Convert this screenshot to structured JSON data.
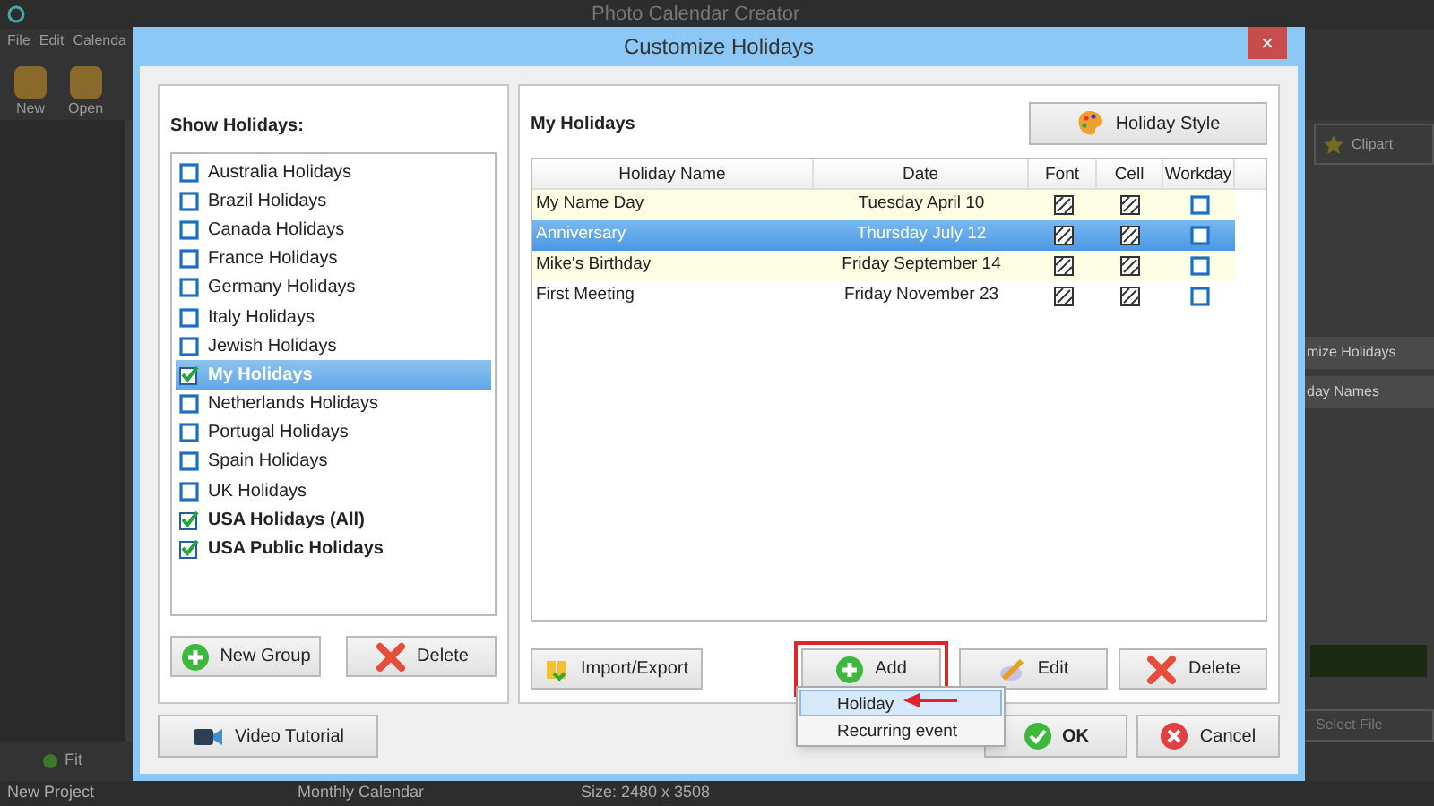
{
  "app": {
    "title": "Photo Calendar Creator",
    "menu": [
      "File",
      "Edit",
      "Calenda"
    ],
    "toolbar": [
      "New",
      "Open"
    ],
    "clipart": "Clipart",
    "side_buttons": [
      "mize Holidays",
      "day Names"
    ],
    "select_file": "Select File",
    "zoom": "Fit",
    "status_bar": [
      "New Project",
      "Monthly Calendar",
      "Size: 2480 x 3508"
    ]
  },
  "dialog": {
    "title": "Customize Holidays",
    "close": "×",
    "show_holidays": {
      "title": "Show Holidays:",
      "items": [
        {
          "label": "Australia Holidays",
          "checked": false,
          "selected": false,
          "bold": false
        },
        {
          "label": "Brazil Holidays",
          "checked": false,
          "selected": false,
          "bold": false
        },
        {
          "label": "Canada Holidays",
          "checked": false,
          "selected": false,
          "bold": false
        },
        {
          "label": "France Holidays",
          "checked": false,
          "selected": false,
          "bold": false
        },
        {
          "label": "Germany Holidays",
          "checked": false,
          "selected": false,
          "bold": false
        },
        {
          "label": "Italy Holidays",
          "checked": false,
          "selected": false,
          "bold": false
        },
        {
          "label": "Jewish Holidays",
          "checked": false,
          "selected": false,
          "bold": false
        },
        {
          "label": "My Holidays",
          "checked": true,
          "selected": true,
          "bold": true
        },
        {
          "label": "Netherlands Holidays",
          "checked": false,
          "selected": false,
          "bold": false
        },
        {
          "label": "Portugal Holidays",
          "checked": false,
          "selected": false,
          "bold": false
        },
        {
          "label": "Spain Holidays",
          "checked": false,
          "selected": false,
          "bold": false
        },
        {
          "label": "UK Holidays",
          "checked": false,
          "selected": false,
          "bold": false
        },
        {
          "label": "USA Holidays (All)",
          "checked": true,
          "selected": false,
          "bold": true
        },
        {
          "label": "USA Public Holidays",
          "checked": true,
          "selected": false,
          "bold": true
        }
      ],
      "buttons": [
        "New Group",
        "Delete"
      ]
    },
    "my_holidays": {
      "title": "My Holidays",
      "style_button": "Holiday Style",
      "columns": [
        "Holiday Name",
        "Date",
        "Font",
        "Cell",
        "Workday"
      ],
      "rows": [
        {
          "name": "My Name Day",
          "date": "Tuesday April 10",
          "font": true,
          "cell": true,
          "workday": false,
          "selected": false
        },
        {
          "name": "Anniversary",
          "date": "Thursday July 12",
          "font": true,
          "cell": true,
          "workday": false,
          "selected": true
        },
        {
          "name": "Mike's Birthday",
          "date": "Friday September 14",
          "font": true,
          "cell": true,
          "workday": false,
          "selected": false
        },
        {
          "name": "First Meeting",
          "date": "Friday November 23",
          "font": true,
          "cell": true,
          "workday": false,
          "selected": false
        }
      ],
      "import_export": "Import/Export",
      "add": "Add",
      "add_highlighted": true,
      "edit": "Edit",
      "delete": "Delete"
    },
    "add_menu": [
      {
        "label": "Holiday",
        "selected": true
      },
      {
        "label": "Recurring event",
        "selected": false
      }
    ],
    "video_tutorial": "Video Tutorial",
    "ok": "OK",
    "cancel": "Cancel"
  }
}
